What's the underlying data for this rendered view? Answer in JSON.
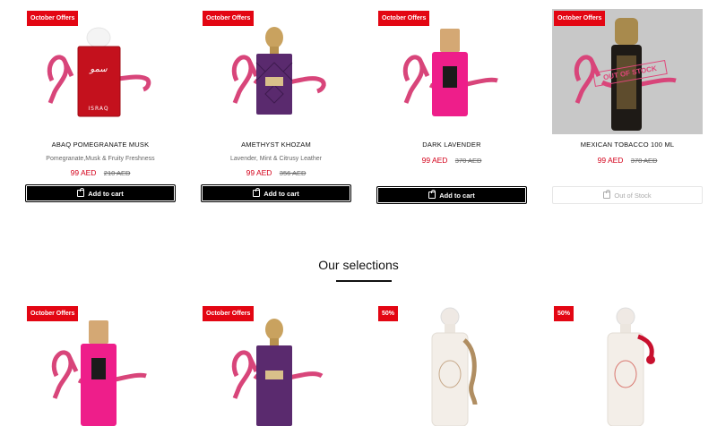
{
  "top_products": [
    {
      "badge": "October Offers",
      "name": "ABAQ POMEGRANATE MUSK",
      "notes": "Pomegranate,Musk & Fruity Freshness",
      "price": "99 AED",
      "old_price": "210 AED",
      "button": "Add to cart"
    },
    {
      "badge": "October Offers",
      "name": "AMETHYST KHOZAM",
      "notes": "Lavender, Mint & Citrusy Leather",
      "price": "99 AED",
      "old_price": "356 AED",
      "button": "Add to cart"
    },
    {
      "badge": "October Offers",
      "name": "DARK LAVENDER",
      "price": "99 AED",
      "old_price": "370 AED",
      "button": "Add to cart"
    },
    {
      "badge": "October Offers",
      "name": "MEXICAN TOBACCO 100 ML",
      "price": "99 AED",
      "old_price": "378 AED",
      "button": "Out of Stock",
      "stamp": "OUT OF STOCK"
    }
  ],
  "section": {
    "title": "Our selections"
  },
  "bottom_products": [
    {
      "badge": "October Offers"
    },
    {
      "badge": "October Offers"
    },
    {
      "badge": "50%"
    },
    {
      "badge": "50%"
    }
  ],
  "colors": {
    "badge": "#e30613",
    "price": "#d4001a",
    "ribbon": "#d8457a"
  }
}
